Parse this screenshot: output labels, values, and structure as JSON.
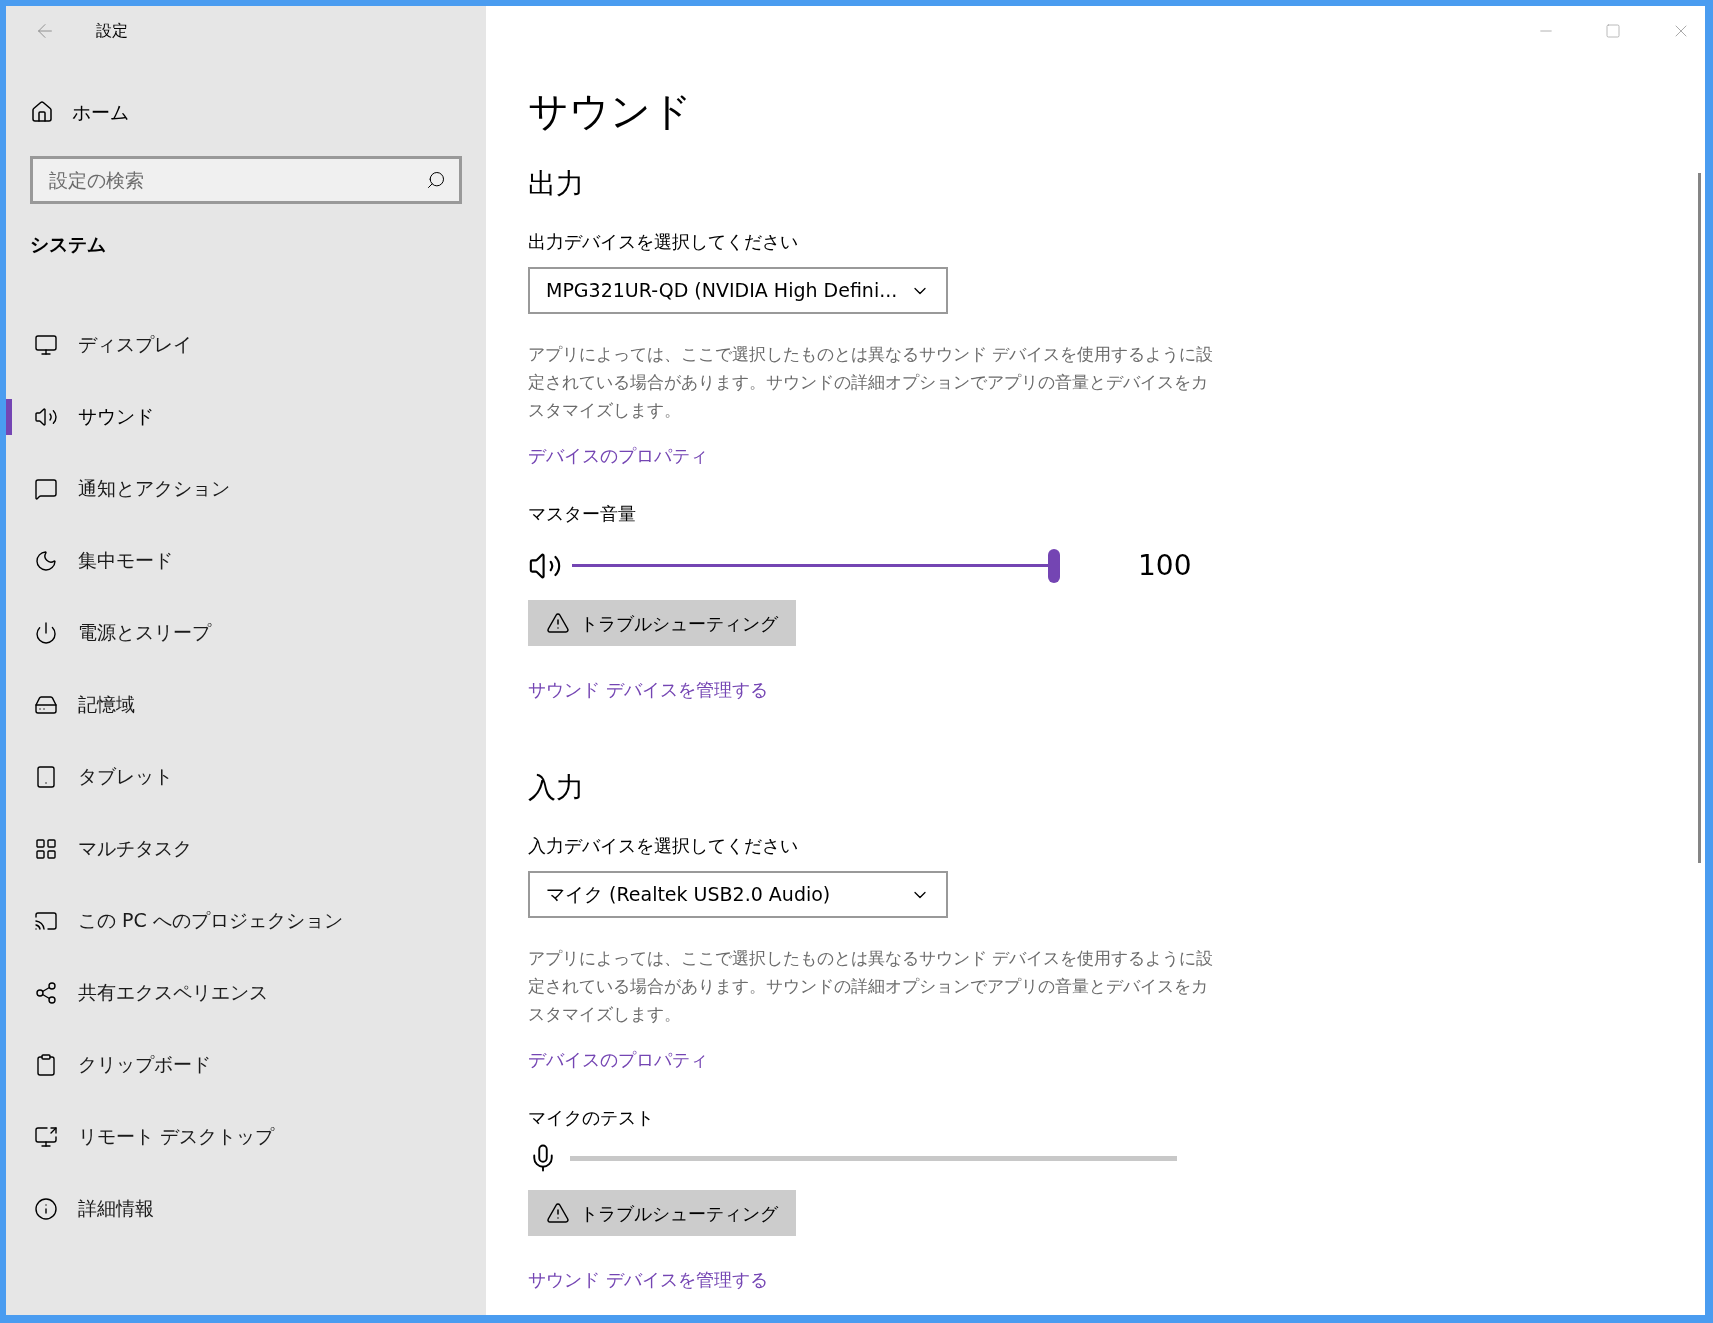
{
  "window": {
    "title": "設定"
  },
  "sidebar": {
    "home": "ホーム",
    "search": {
      "placeholder": "設定の検索"
    },
    "section": "システム",
    "items": [
      {
        "label": "ディスプレイ",
        "selected": false
      },
      {
        "label": "サウンド",
        "selected": true
      },
      {
        "label": "通知とアクション",
        "selected": false
      },
      {
        "label": "集中モード",
        "selected": false
      },
      {
        "label": "電源とスリープ",
        "selected": false
      },
      {
        "label": "記憶域",
        "selected": false
      },
      {
        "label": "タブレット",
        "selected": false
      },
      {
        "label": "マルチタスク",
        "selected": false
      },
      {
        "label": "この PC へのプロジェクション",
        "selected": false
      },
      {
        "label": "共有エクスペリエンス",
        "selected": false
      },
      {
        "label": "クリップボード",
        "selected": false
      },
      {
        "label": "リモート デスクトップ",
        "selected": false
      },
      {
        "label": "詳細情報",
        "selected": false
      }
    ]
  },
  "page": {
    "title": "サウンド",
    "output": {
      "heading": "出力",
      "device_label": "出力デバイスを選択してください",
      "device": "MPG321UR-QD (NVIDIA High Defini...",
      "description": "アプリによっては、ここで選択したものとは異なるサウンド デバイスを使用するように設定されている場合があります。サウンドの詳細オプションでアプリの音量とデバイスをカスタマイズします。",
      "properties_link": "デバイスのプロパティ",
      "volume_label": "マスター音量",
      "volume": {
        "level": 1.0,
        "reading": "100"
      },
      "troubleshoot": "トラブルシューティング",
      "manage_link": "サウンド デバイスを管理する"
    },
    "input": {
      "heading": "入力",
      "device_label": "入力デバイスを選択してください",
      "device": "マイク (Realtek USB2.0 Audio)",
      "description": "アプリによっては、ここで選択したものとは異なるサウンド デバイスを使用するように設定されている場合があります。サウンドの詳細オプションでアプリの音量とデバイスをカスタマイズします。",
      "properties_link": "デバイスのプロパティ",
      "test_label": "マイクのテスト",
      "troubleshoot": "トラブルシューティング",
      "manage_link": "サウンド デバイスを管理する"
    }
  }
}
